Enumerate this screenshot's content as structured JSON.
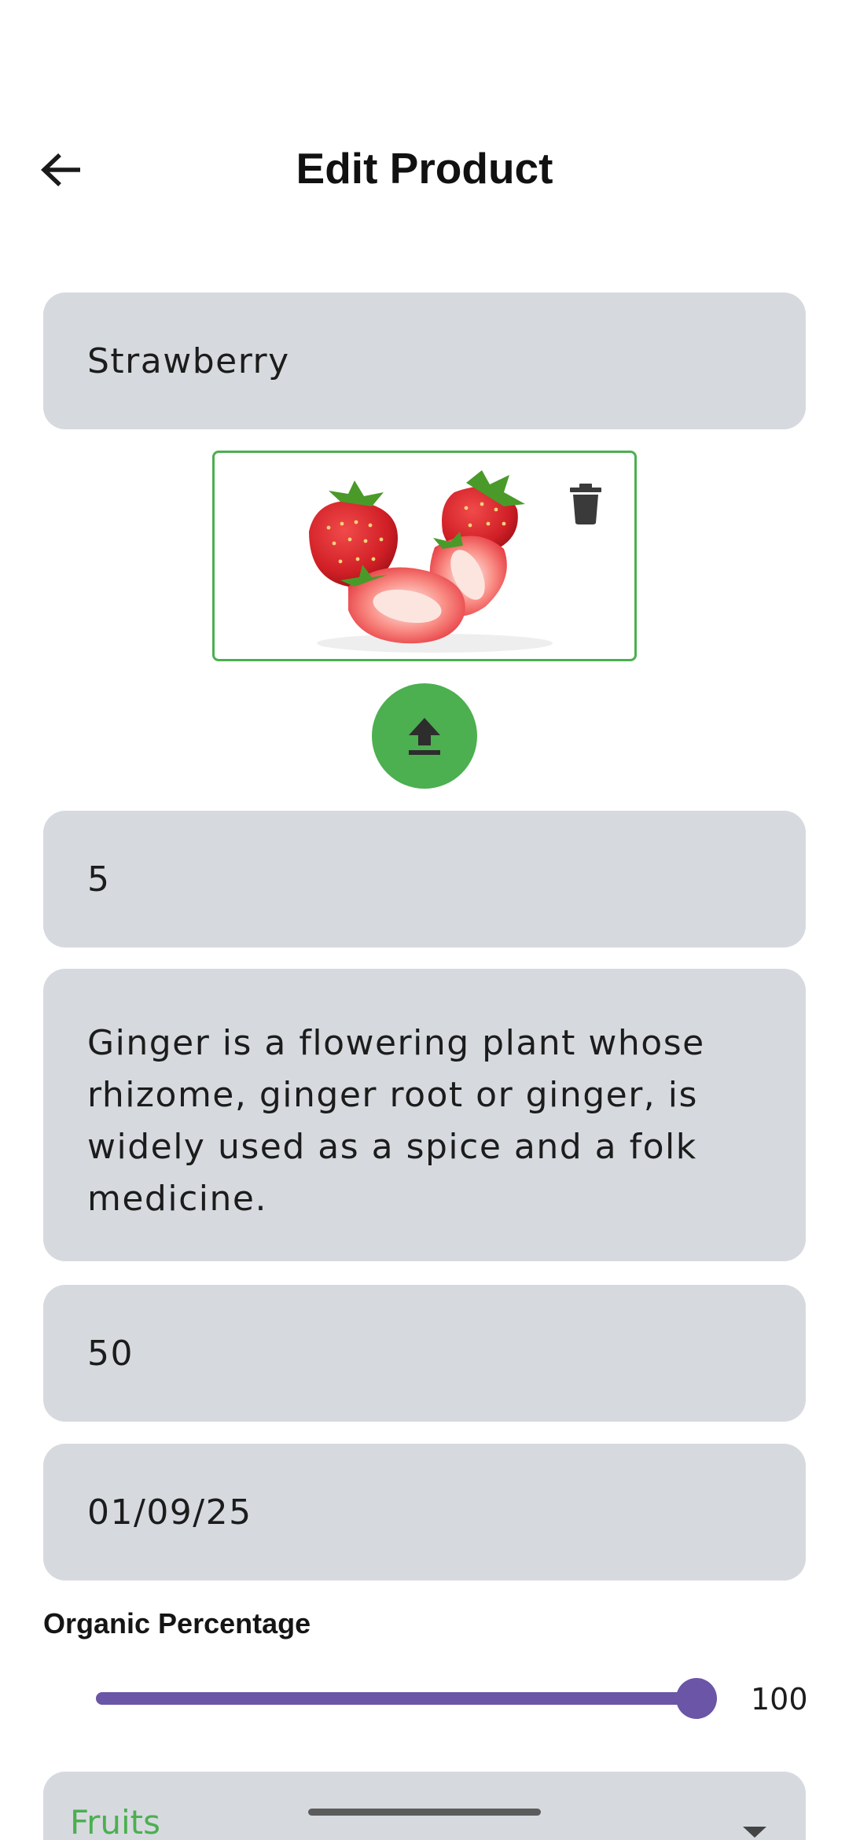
{
  "header": {
    "title": "Edit Product"
  },
  "form": {
    "name": "Strawberry",
    "quantity": "5",
    "description": "Ginger is a flowering plant whose rhizome, ginger root or ginger, is widely used as a spice and a folk medicine.",
    "price": "50",
    "date": "01/09/25"
  },
  "organic": {
    "label": "Organic Percentage",
    "value": 100,
    "value_label": "100",
    "min": 0,
    "max": 100
  },
  "category": {
    "selected": "Fruits"
  },
  "colors": {
    "accent_green": "#4caf50",
    "slider_purple": "#6b55a6",
    "field_bg": "#d6dadf"
  },
  "icons": {
    "back": "arrow-back-icon",
    "delete": "trash-icon",
    "upload": "upload-icon",
    "dropdown": "caret-down-icon"
  }
}
